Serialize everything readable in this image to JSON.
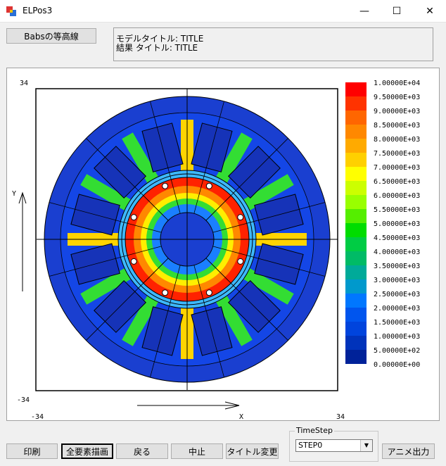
{
  "window": {
    "title": "ELPos3",
    "minimize": "—",
    "maximize": "☐",
    "close": "✕"
  },
  "contour_button": "Babsの等高線",
  "title_box": {
    "model_title": "モデルタイトル: TITLE",
    "result_title": "結果  タイトル: TITLE"
  },
  "plot": {
    "y_max": "34",
    "y_min": "-34",
    "x_min": "-34",
    "x_max": "34",
    "y_axis_label": "Y",
    "x_axis_label": "X"
  },
  "legend": {
    "values": [
      "1.00000E+04",
      "9.50000E+03",
      "9.00000E+03",
      "8.50000E+03",
      "8.00000E+03",
      "7.50000E+03",
      "7.00000E+03",
      "6.50000E+03",
      "6.00000E+03",
      "5.50000E+03",
      "5.00000E+03",
      "4.50000E+03",
      "4.00000E+03",
      "3.50000E+03",
      "3.00000E+03",
      "2.50000E+03",
      "2.00000E+03",
      "1.50000E+03",
      "1.00000E+03",
      "5.00000E+02",
      "0.00000E+00"
    ],
    "colors": [
      "#ff0000",
      "#ff3300",
      "#ff6600",
      "#ff8800",
      "#ffaa00",
      "#ffd000",
      "#ffff00",
      "#ccff00",
      "#99ff00",
      "#55ee00",
      "#00dd00",
      "#00cc44",
      "#00bb66",
      "#00aa99",
      "#0099cc",
      "#0077ff",
      "#0055ee",
      "#0044dd",
      "#0033bb",
      "#002299",
      "#001a88"
    ]
  },
  "timestep": {
    "label": "TimeStep",
    "value": "STEP0"
  },
  "buttons": {
    "print": "印刷",
    "draw_all": "全要素描画",
    "back": "戻る",
    "stop": "中止",
    "change_title": "タイトル変更",
    "anim_output": "アニメ出力"
  }
}
